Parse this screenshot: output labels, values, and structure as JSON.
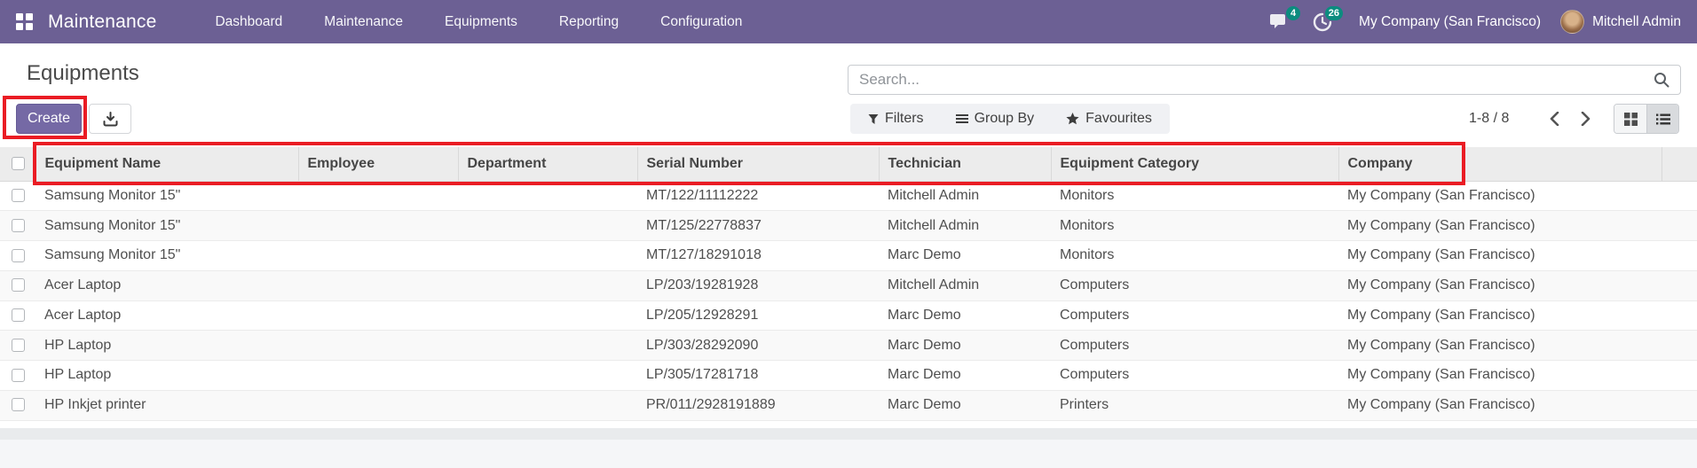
{
  "nav": {
    "app_title": "Maintenance",
    "menu_items": [
      "Dashboard",
      "Maintenance",
      "Equipments",
      "Reporting",
      "Configuration"
    ],
    "messages_badge": "4",
    "activities_badge": "26",
    "company": "My Company (San Francisco)",
    "user": "Mitchell Admin"
  },
  "page": {
    "title": "Equipments",
    "create_label": "Create",
    "search_placeholder": "Search...",
    "filters_label": "Filters",
    "group_by_label": "Group By",
    "favourites_label": "Favourites",
    "pager": "1-8 / 8",
    "active_view": "list"
  },
  "icons": {
    "apps": "apps-grid-icon",
    "messages": "chat-bubble-icon",
    "activities": "clock-icon",
    "search": "magnifier-icon",
    "export": "download-icon",
    "filters": "funnel-icon",
    "group_by": "lines-icon",
    "favourites": "star-icon",
    "pager_prev": "chevron-left-icon",
    "pager_next": "chevron-right-icon",
    "kanban_view": "grid-icon",
    "list_view": "list-icon"
  },
  "colors": {
    "navbar": "#6c6094",
    "primary": "#7569a5",
    "badge": "#0c8c7f",
    "annotation": "#ea1c24"
  },
  "table": {
    "columns": [
      "Equipment Name",
      "Employee",
      "Department",
      "Serial Number",
      "Technician",
      "Equipment Category",
      "Company"
    ],
    "rows": [
      [
        "Samsung Monitor 15\"",
        "",
        "",
        "MT/122/11112222",
        "Mitchell Admin",
        "Monitors",
        "My Company (San Francisco)"
      ],
      [
        "Samsung Monitor 15\"",
        "",
        "",
        "MT/125/22778837",
        "Mitchell Admin",
        "Monitors",
        "My Company (San Francisco)"
      ],
      [
        "Samsung Monitor 15\"",
        "",
        "",
        "MT/127/18291018",
        "Marc Demo",
        "Monitors",
        "My Company (San Francisco)"
      ],
      [
        "Acer Laptop",
        "",
        "",
        "LP/203/19281928",
        "Mitchell Admin",
        "Computers",
        "My Company (San Francisco)"
      ],
      [
        "Acer Laptop",
        "",
        "",
        "LP/205/12928291",
        "Marc Demo",
        "Computers",
        "My Company (San Francisco)"
      ],
      [
        "HP Laptop",
        "",
        "",
        "LP/303/28292090",
        "Marc Demo",
        "Computers",
        "My Company (San Francisco)"
      ],
      [
        "HP Laptop",
        "",
        "",
        "LP/305/17281718",
        "Marc Demo",
        "Computers",
        "My Company (San Francisco)"
      ],
      [
        "HP Inkjet printer",
        "",
        "",
        "PR/011/2928191889",
        "Marc Demo",
        "Printers",
        "My Company (San Francisco)"
      ]
    ]
  }
}
